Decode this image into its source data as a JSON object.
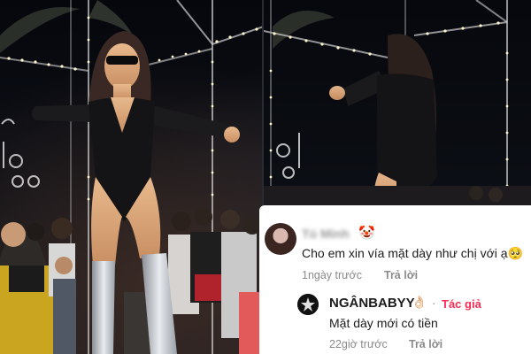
{
  "comments": [
    {
      "username": "Tú Minh",
      "badge_emoji": "🤡",
      "text": "Cho em xin vía mặt dày như chị với ạ🥺",
      "time": "1ngày trước",
      "reply_label": "Trả lời"
    },
    {
      "username": "NGÂNBABYY",
      "username_suffix": "👌🏻",
      "separator": "·",
      "author_label": "Tác giả",
      "text": "Mặt dày mới có tiền",
      "time": "22giờ trước",
      "reply_label": "Trả lời"
    }
  ],
  "colors": {
    "author_accent": "#fe2c55",
    "card_bg": "#ffffff"
  }
}
